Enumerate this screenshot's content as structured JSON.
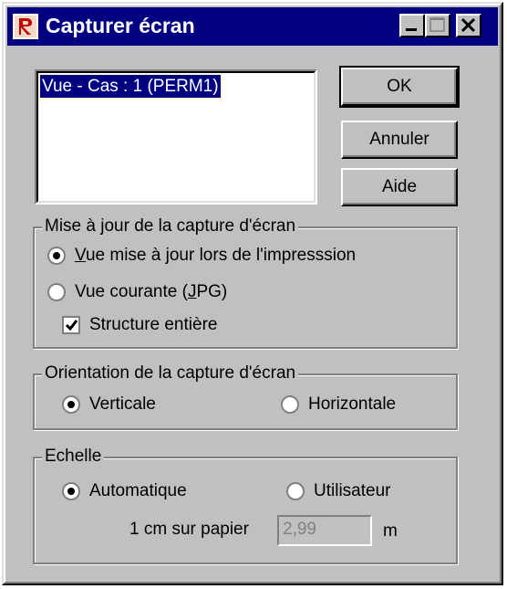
{
  "window": {
    "title": "Capturer écran"
  },
  "listbox": {
    "items": [
      "Vue - Cas : 1 (PERM1)"
    ]
  },
  "buttons": {
    "ok": "OK",
    "cancel": "Annuler",
    "help": "Aide"
  },
  "update_group": {
    "legend": "Mise à jour de la capture d'écran",
    "option_print_prefix": "",
    "option_print_underline": "V",
    "option_print_rest": "ue mise à jour lors de l'impresssion",
    "option_print_selected": true,
    "option_current_prefix": "Vue courante (",
    "option_current_underline": "J",
    "option_current_rest": "PG)",
    "option_current_selected": false,
    "checkbox_label": "Structure entière",
    "checkbox_checked": true
  },
  "orientation_group": {
    "legend": "Orientation de la capture d'écran",
    "vertical": "Verticale",
    "horizontal": "Horizontale",
    "selected": "vertical"
  },
  "scale_group": {
    "legend": "Echelle",
    "automatic": "Automatique",
    "user": "Utilisateur",
    "selected": "automatic",
    "paper_label": "1 cm sur papier",
    "paper_value": "2,99",
    "unit": "m"
  },
  "colors": {
    "face": "#c0c0c0",
    "titlebar": "#000080",
    "selection": "#000080"
  }
}
